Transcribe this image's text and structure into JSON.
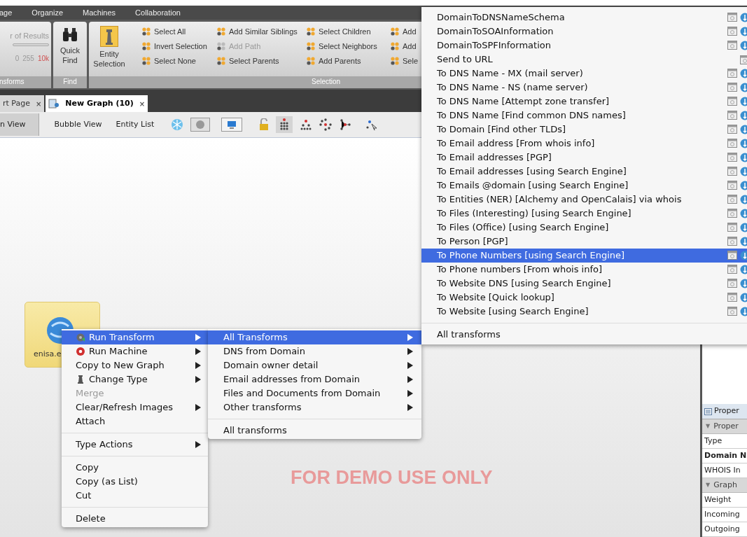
{
  "menubar": [
    {
      "label": "age"
    },
    {
      "label": "Organize"
    },
    {
      "label": "Machines"
    },
    {
      "label": "Collaboration"
    }
  ],
  "ribbon": {
    "results": {
      "label": "r of Results",
      "ticks": [
        {
          "label": "0",
          "selected": false
        },
        {
          "label": "255",
          "selected": false
        },
        {
          "label": "10k",
          "selected": true
        }
      ],
      "title": "nsforms"
    },
    "find": {
      "button": "Quick Find",
      "title": "Find"
    },
    "selection": {
      "button": "Entity Selection",
      "title": "Selection",
      "columns": [
        [
          {
            "label": "Select All",
            "disabled": false
          },
          {
            "label": "Invert Selection",
            "disabled": false
          },
          {
            "label": "Select None",
            "disabled": false
          }
        ],
        [
          {
            "label": "Add Similar Siblings",
            "disabled": false
          },
          {
            "label": "Add Path",
            "disabled": true
          },
          {
            "label": "Select Parents",
            "disabled": false
          }
        ],
        [
          {
            "label": "Select Children",
            "disabled": false
          },
          {
            "label": "Select Neighbors",
            "disabled": false
          },
          {
            "label": "Add Parents",
            "disabled": false
          }
        ],
        [
          {
            "label": "Add",
            "disabled": false
          },
          {
            "label": "Add",
            "disabled": false
          },
          {
            "label": "Sele",
            "disabled": false
          }
        ]
      ]
    }
  },
  "tabs": [
    {
      "label": "rt Page",
      "selected": false,
      "close": "×"
    },
    {
      "label": "New Graph (10)",
      "selected": true,
      "close": "×"
    }
  ],
  "views": [
    {
      "label": "n View",
      "selected": true
    },
    {
      "label": "Bubble View",
      "selected": false
    },
    {
      "label": "Entity List",
      "selected": false
    }
  ],
  "canvas": {
    "node": {
      "label": "enisa.e"
    },
    "notice": "FOR DEMO USE ONLY"
  },
  "properties": {
    "header": "Proper",
    "sections": [
      {
        "title": "Proper",
        "toggle": "▼",
        "expanded": true,
        "rows": [
          {
            "label": "Type",
            "bold": false
          },
          {
            "label": "Domain N",
            "bold": true
          },
          {
            "label": "WHOIS In",
            "bold": false
          }
        ]
      },
      {
        "title": "Graph",
        "toggle": "▼",
        "expanded": true,
        "rows": [
          {
            "label": "Weight",
            "bold": false
          },
          {
            "label": "Incoming",
            "bold": false
          },
          {
            "label": "Outgoing",
            "bold": false
          }
        ]
      }
    ]
  },
  "context_menu": {
    "groups": [
      [
        {
          "label": "Run Transform",
          "submenu": true,
          "selected": true,
          "disabled": false
        },
        {
          "label": "Run Machine",
          "submenu": true,
          "selected": false,
          "disabled": false
        },
        {
          "label": "Copy to New Graph",
          "submenu": true,
          "selected": false,
          "disabled": false
        },
        {
          "label": "Change Type",
          "submenu": true,
          "selected": false,
          "disabled": false
        },
        {
          "label": "Merge",
          "submenu": false,
          "selected": false,
          "disabled": true
        },
        {
          "label": "Clear/Refresh Images",
          "submenu": true,
          "selected": false,
          "disabled": false
        },
        {
          "label": "Attach",
          "submenu": false,
          "selected": false,
          "disabled": false
        }
      ],
      [
        {
          "label": "Type Actions",
          "submenu": true,
          "selected": false,
          "disabled": false
        }
      ],
      [
        {
          "label": "Copy",
          "submenu": false,
          "selected": false,
          "disabled": false
        },
        {
          "label": "Copy (as List)",
          "submenu": false,
          "selected": false,
          "disabled": false
        },
        {
          "label": "Cut",
          "submenu": false,
          "selected": false,
          "disabled": false
        }
      ],
      [
        {
          "label": "Delete",
          "submenu": false,
          "selected": false,
          "disabled": false
        }
      ]
    ]
  },
  "submenu": {
    "items": [
      {
        "label": "All Transforms",
        "selected": true
      },
      {
        "label": "DNS from Domain",
        "selected": false
      },
      {
        "label": "Domain owner detail",
        "selected": false
      },
      {
        "label": "Email addresses from Domain",
        "selected": false
      },
      {
        "label": "Files and Documents from Domain",
        "selected": false
      },
      {
        "label": "Other transforms",
        "selected": false
      }
    ],
    "footer": "All transforms"
  },
  "transforms": {
    "items": [
      {
        "label": "DomainToDNSNameSchema",
        "kind": "web",
        "selected": false
      },
      {
        "label": "DomainToSOAInformation",
        "kind": "web",
        "selected": false
      },
      {
        "label": "DomainToSPFInformation",
        "kind": "web",
        "selected": false
      },
      {
        "label": "Send to URL",
        "kind": "local",
        "selected": false
      },
      {
        "label": "To DNS Name - MX (mail server)",
        "kind": "web",
        "selected": false
      },
      {
        "label": "To DNS Name - NS (name server)",
        "kind": "web",
        "selected": false
      },
      {
        "label": "To DNS Name [Attempt zone transfer]",
        "kind": "web",
        "selected": false
      },
      {
        "label": "To DNS Name [Find common DNS names]",
        "kind": "web",
        "selected": false
      },
      {
        "label": "To Domain [Find other TLDs]",
        "kind": "web",
        "selected": false
      },
      {
        "label": "To Email address [From whois info]",
        "kind": "web",
        "selected": false
      },
      {
        "label": "To Email addresses [PGP]",
        "kind": "web",
        "selected": false
      },
      {
        "label": "To Email addresses [using Search Engine]",
        "kind": "web",
        "selected": false
      },
      {
        "label": "To Emails @domain [using Search Engine]",
        "kind": "web",
        "selected": false
      },
      {
        "label": "To Entities (NER) [Alchemy and OpenCalais] via whois",
        "kind": "web",
        "selected": false
      },
      {
        "label": "To Files (Interesting) [using Search Engine]",
        "kind": "web",
        "selected": false
      },
      {
        "label": "To Files (Office) [using Search Engine]",
        "kind": "web",
        "selected": false
      },
      {
        "label": "To Person [PGP]",
        "kind": "web",
        "selected": false
      },
      {
        "label": "To Phone Numbers [using Search Engine]",
        "kind": "web",
        "selected": true
      },
      {
        "label": "To Phone numbers [From whois info]",
        "kind": "web",
        "selected": false
      },
      {
        "label": "To Website DNS [using Search Engine]",
        "kind": "web",
        "selected": false
      },
      {
        "label": "To Website [Quick lookup]",
        "kind": "web",
        "selected": false
      },
      {
        "label": "To Website [using Search Engine]",
        "kind": "web",
        "selected": false
      }
    ],
    "footer": "All transforms"
  }
}
